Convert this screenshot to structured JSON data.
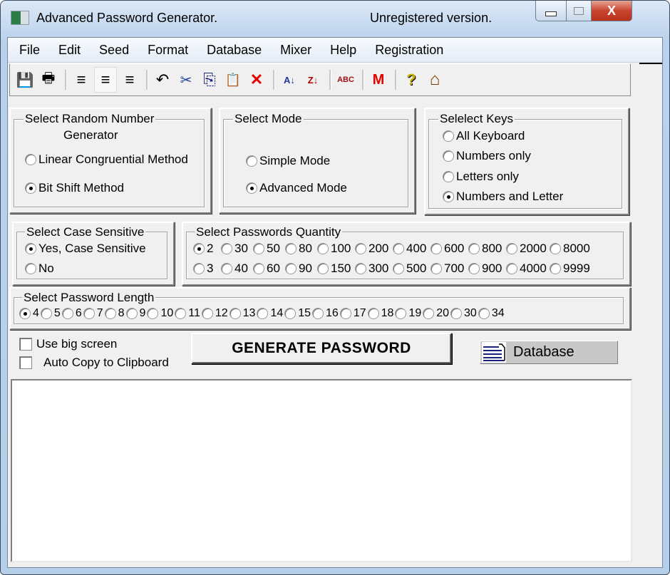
{
  "window": {
    "title": "Advanced Password Generator.",
    "status": "Unregistered version.",
    "controls": {
      "minimize": "minimize",
      "maximize": "maximize",
      "close": "X"
    }
  },
  "menu": [
    "File",
    "Edit",
    "Seed",
    "Format",
    "Database",
    "Mixer",
    "Help",
    "Registration"
  ],
  "toolbar": [
    {
      "icon": "save-icon",
      "glyph": "💾"
    },
    {
      "icon": "print-icon",
      "glyph": "🖶"
    },
    {
      "sep": true
    },
    {
      "icon": "align-left-icon",
      "glyph": "≡"
    },
    {
      "icon": "align-center-icon",
      "glyph": "≡",
      "pressed": true
    },
    {
      "icon": "align-right-icon",
      "glyph": "≡"
    },
    {
      "sep": true
    },
    {
      "icon": "undo-icon",
      "glyph": "↶"
    },
    {
      "icon": "cut-icon",
      "glyph": "✂"
    },
    {
      "icon": "copy-icon",
      "glyph": "⎘"
    },
    {
      "icon": "paste-icon",
      "glyph": "📋"
    },
    {
      "icon": "delete-icon",
      "glyph": "✕"
    },
    {
      "sep": true
    },
    {
      "icon": "sort-ascending-icon",
      "glyph": "A↓"
    },
    {
      "icon": "sort-descending-icon",
      "glyph": "Z↓"
    },
    {
      "sep": true
    },
    {
      "icon": "spellcheck-icon",
      "glyph": "ABC"
    },
    {
      "sep": true
    },
    {
      "icon": "mixer-m-icon",
      "glyph": "M"
    },
    {
      "sep": true
    },
    {
      "icon": "help-icon",
      "glyph": "?"
    },
    {
      "icon": "home-icon",
      "glyph": "⌂"
    }
  ],
  "rng_group": {
    "title_line1": "Select  Random  Number",
    "title_line2": "Generator",
    "options": [
      {
        "label": "Linear Congruential Method",
        "selected": false
      },
      {
        "label": "Bit Shift Method",
        "selected": true
      }
    ]
  },
  "mode_group": {
    "title": "Select  Mode",
    "options": [
      {
        "label": "Simple Mode",
        "selected": false
      },
      {
        "label": "Advanced Mode",
        "selected": true
      }
    ]
  },
  "keys_group": {
    "title": "Selelect  Keys",
    "options": [
      {
        "label": "All Keyboard",
        "selected": false
      },
      {
        "label": "Numbers only",
        "selected": false
      },
      {
        "label": "Letters only",
        "selected": false
      },
      {
        "label": "Numbers and Letter",
        "selected": true
      }
    ]
  },
  "case_group": {
    "title": "Select Case Sensitive",
    "options": [
      {
        "label": "Yes, Case Sensitive",
        "selected": true
      },
      {
        "label": "No",
        "selected": false
      }
    ]
  },
  "quantity_group": {
    "title": "Select  Passwords  Quantity",
    "row1": [
      "2",
      "30",
      "50",
      "80",
      "100",
      "200",
      "400",
      "600",
      "800",
      "2000",
      "8000"
    ],
    "row2": [
      "3",
      "40",
      "60",
      "90",
      "150",
      "300",
      "500",
      "700",
      "900",
      "4000",
      "9999"
    ],
    "selected": "2"
  },
  "length_group": {
    "title": "Select  Password  Length",
    "options": [
      "4",
      "5",
      "6",
      "7",
      "8",
      "9",
      "10",
      "11",
      "12",
      "13",
      "14",
      "15",
      "16",
      "17",
      "18",
      "19",
      "20",
      "30",
      "34"
    ],
    "selected": "4"
  },
  "checkboxes": [
    {
      "label": "Use big screen",
      "checked": false
    },
    {
      "label": "Auto Copy to Clipboard",
      "checked": false
    }
  ],
  "buttons": {
    "generate": "GENERATE PASSWORD",
    "database": "Database"
  },
  "output": {
    "text": ""
  },
  "colors": {
    "accent_red": "#e00000",
    "frame_blue": "#b5cfea",
    "dialog_gray": "#f0f0f0"
  }
}
